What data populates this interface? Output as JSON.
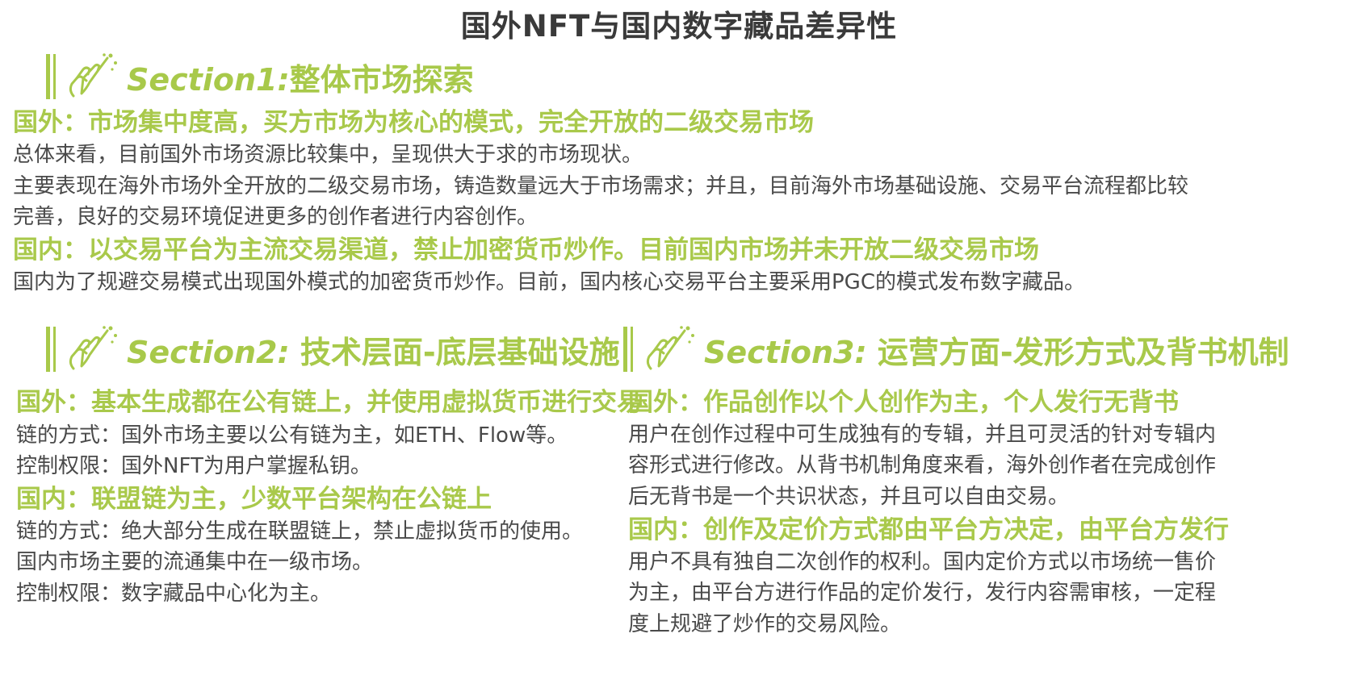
{
  "title": "国外NFT与国内数字藏品差异性",
  "colors": {
    "accent": "#a8c94a",
    "text": "#4a4a4a",
    "title": "#3a3a3a"
  },
  "icons": [
    "hand-pen-icon"
  ],
  "sections": [
    {
      "heading_en": "Section1:",
      "heading_cn": "整体市场探索",
      "blocks": [
        {
          "heading": "国外：市场集中度高，买方市场为核心的模式，完全开放的二级交易市场",
          "lines": [
            "总体来看，目前国外市场资源比较集中，呈现供大于求的市场现状。",
            "主要表现在海外市场外全开放的二级交易市场，铸造数量远大于市场需求；并且，目前海外市场基础设施、交易平台流程都比较",
            "完善，良好的交易环境促进更多的创作者进行内容创作。"
          ]
        },
        {
          "heading": "国内：以交易平台为主流交易渠道，禁止加密货币炒作。目前国内市场并未开放二级交易市场",
          "lines": [
            "国内为了规避交易模式出现国外模式的加密货币炒作。目前，国内核心交易平台主要采用PGC的模式发布数字藏品。"
          ]
        }
      ]
    },
    {
      "heading_en": "Section2:",
      "heading_cn": "技术层面-底层基础设施",
      "blocks": [
        {
          "heading": "国外：基本生成都在公有链上，并使用虚拟货币进行交易",
          "lines": [
            "链的方式：国外市场主要以公有链为主，如ETH、Flow等。",
            "控制权限：国外NFT为用户掌握私钥。"
          ]
        },
        {
          "heading": "国内：联盟链为主，少数平台架构在公链上",
          "lines": [
            "链的方式：绝大部分生成在联盟链上，禁止虚拟货币的使用。",
            "国内市场主要的流通集中在一级市场。",
            "控制权限：数字藏品中心化为主。"
          ]
        }
      ]
    },
    {
      "heading_en": "Section3:",
      "heading_cn": "运营方面-发形方式及背书机制",
      "blocks": [
        {
          "heading": "国外：作品创作以个人创作为主，个人发行无背书",
          "lines": [
            "用户在创作过程中可生成独有的专辑，并且可灵活的针对专辑内",
            "容形式进行修改。从背书机制角度来看，海外创作者在完成创作",
            "后无背书是一个共识状态，并且可以自由交易。"
          ]
        },
        {
          "heading": "国内：创作及定价方式都由平台方决定，由平台方发行",
          "lines": [
            "用户不具有独自二次创作的权利。国内定价方式以市场统一售价",
            "为主，由平台方进行作品的定价发行，发行内容需审核，一定程",
            "度上规避了炒作的交易风险。"
          ]
        }
      ]
    }
  ]
}
